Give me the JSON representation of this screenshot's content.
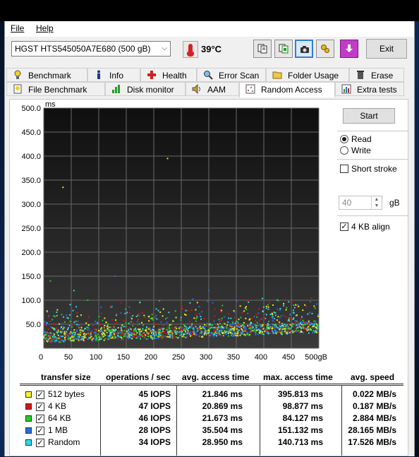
{
  "menu": {
    "file": "File",
    "help": "Help"
  },
  "toolbar": {
    "drive": "HGST HTS545050A7E680 (500 gB)",
    "temperature": "39°C",
    "exit_label": "Exit",
    "buttons": [
      "copy-text-icon",
      "copy-clipboard-icon",
      "screenshot-camera-icon",
      "options-icon",
      "save-download-icon"
    ]
  },
  "tabs": {
    "row1": [
      "Benchmark",
      "Info",
      "Health",
      "Error Scan",
      "Folder Usage",
      "Erase"
    ],
    "row2": [
      "File Benchmark",
      "Disk monitor",
      "AAM",
      "Random Access",
      "Extra tests"
    ],
    "active": "Random Access"
  },
  "side": {
    "start": "Start",
    "read": "Read",
    "write": "Write",
    "short_stroke": "Short stroke",
    "stroke_value": "40",
    "stroke_unit": "gB",
    "align": "4 KB align"
  },
  "chart_data": {
    "type": "scatter",
    "ylabel": "ms",
    "y_ticks": [
      "500.0",
      "450.0",
      "400.0",
      "350.0",
      "300.0",
      "250.0",
      "200.0",
      "150.0",
      "100.0",
      "50.0"
    ],
    "x_ticks": [
      "0",
      "50",
      "100",
      "150",
      "200",
      "250",
      "300",
      "350",
      "400",
      "450",
      "500gB"
    ],
    "xlim": [
      0,
      500
    ],
    "ylim": [
      0,
      500
    ],
    "series_colors": {
      "512 bytes": "#e8e82a",
      "4 KB": "#d01818",
      "64 KB": "#28c828",
      "1 MB": "#2a6ae0",
      "Random": "#30d8e8"
    }
  },
  "table": {
    "headers": [
      "transfer size",
      "operations / sec",
      "avg. access time",
      "max. access time",
      "avg. speed"
    ],
    "rows": [
      {
        "size": "512 bytes",
        "color": "#f2f23a",
        "ops": "45 IOPS",
        "avg": "21.846 ms",
        "max": "395.813 ms",
        "speed": "0.022 MB/s"
      },
      {
        "size": "4 KB",
        "color": "#d01818",
        "ops": "47 IOPS",
        "avg": "20.869 ms",
        "max": "98.877 ms",
        "speed": "0.187 MB/s"
      },
      {
        "size": "64 KB",
        "color": "#28c828",
        "ops": "46 IOPS",
        "avg": "21.673 ms",
        "max": "84.127 ms",
        "speed": "2.884 MB/s"
      },
      {
        "size": "1 MB",
        "color": "#2a6ae0",
        "ops": "28 IOPS",
        "avg": "35.504 ms",
        "max": "151.132 ms",
        "speed": "28.165 MB/s"
      },
      {
        "size": "Random",
        "color": "#30d8e8",
        "ops": "34 IOPS",
        "avg": "28.950 ms",
        "max": "140.713 ms",
        "speed": "17.526 MB/s"
      }
    ]
  }
}
